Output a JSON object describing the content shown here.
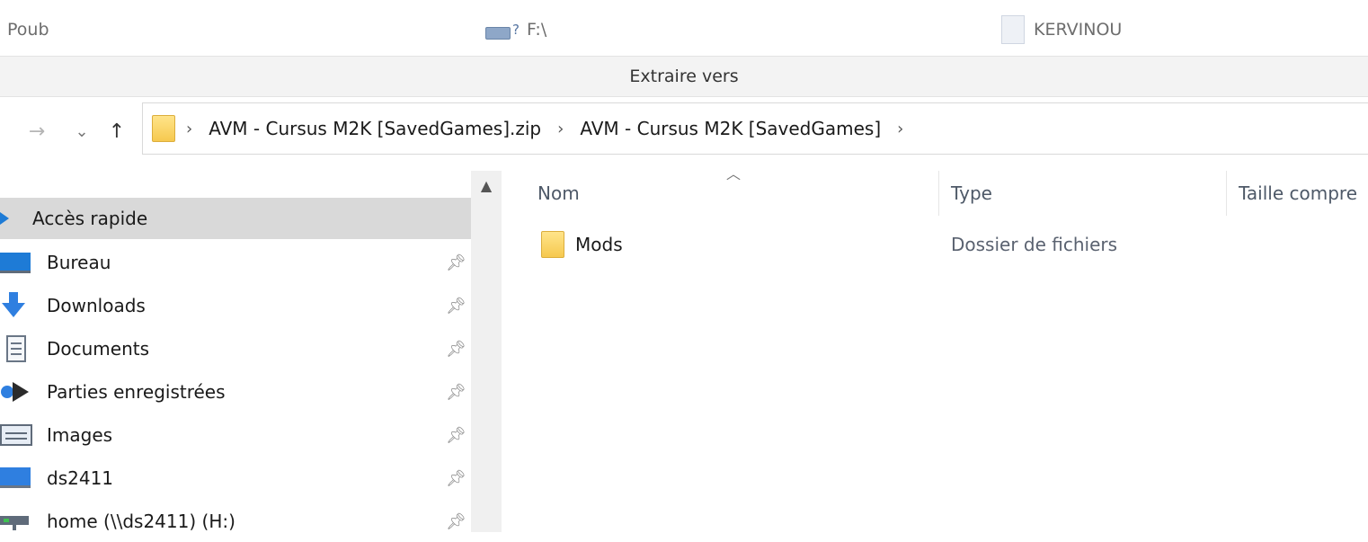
{
  "ribbon": {
    "items": [
      {
        "label": "Poub",
        "icon": "recycle-bin-icon"
      },
      {
        "label": "F:\\",
        "icon": "drive-icon"
      },
      {
        "label": "KERVINOU",
        "icon": "document-icon"
      }
    ],
    "group_label": "Extraire vers"
  },
  "address_bar": {
    "forward_icon": "→",
    "recent_icon": "⌄",
    "up_icon": "↑",
    "crumbs": [
      "AVM - Cursus M2K [SavedGames].zip",
      "AVM - Cursus M2K [SavedGames]"
    ]
  },
  "nav_pane": {
    "items": [
      {
        "label": "Accès rapide",
        "icon": "star-icon",
        "pinned": false,
        "selected": true
      },
      {
        "label": "Bureau",
        "icon": "desktop-icon",
        "pinned": true
      },
      {
        "label": "Downloads",
        "icon": "download-icon",
        "pinned": true
      },
      {
        "label": "Documents",
        "icon": "documents-icon",
        "pinned": true
      },
      {
        "label": "Parties enregistrées",
        "icon": "saved-games-icon",
        "pinned": true
      },
      {
        "label": "Images",
        "icon": "pictures-icon",
        "pinned": true
      },
      {
        "label": "ds2411",
        "icon": "computer-icon",
        "pinned": true
      },
      {
        "label": "home (\\\\ds2411) (H:)",
        "icon": "network-drive-icon",
        "pinned": true
      }
    ]
  },
  "content": {
    "columns": [
      "Nom",
      "Type",
      "Taille compre"
    ],
    "rows": [
      {
        "name": "Mods",
        "type": "Dossier de fichiers"
      }
    ]
  },
  "colors": {
    "accent": "#1e7bd6",
    "folder": "#f6c94f",
    "selected": "#d9d9d9"
  }
}
